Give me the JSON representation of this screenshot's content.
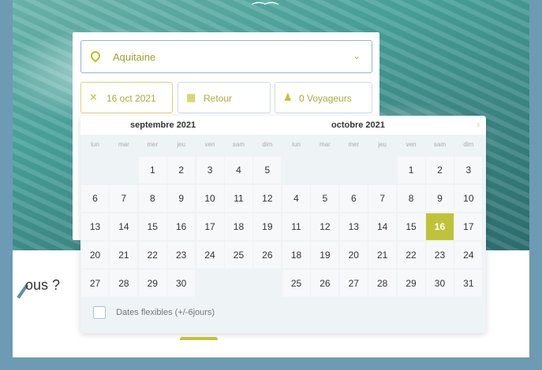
{
  "hero": {
    "title_mark": "..."
  },
  "below_text": "ous ?",
  "search": {
    "destination": "Aquitaine",
    "depart": "16 oct 2021",
    "retour": "Retour",
    "voyageurs": "0 Voyageurs"
  },
  "calendar": {
    "next_label": "›",
    "weekdays": [
      "lun",
      "mar",
      "mer",
      "jeu",
      "ven",
      "sam",
      "dim"
    ],
    "months": [
      {
        "title": "septembre 2021",
        "days": [
          "",
          "",
          "1",
          "2",
          "3",
          "4",
          "5",
          "6",
          "7",
          "8",
          "9",
          "10",
          "11",
          "12",
          "13",
          "14",
          "15",
          "16",
          "17",
          "18",
          "19",
          "20",
          "21",
          "22",
          "23",
          "24",
          "25",
          "26",
          "27",
          "28",
          "29",
          "30"
        ]
      },
      {
        "title": "octobre 2021",
        "days": [
          "",
          "",
          "",
          "",
          "1",
          "2",
          "3",
          "4",
          "5",
          "6",
          "7",
          "8",
          "9",
          "10",
          "11",
          "12",
          "13",
          "14",
          "15",
          "16",
          "17",
          "18",
          "19",
          "20",
          "21",
          "22",
          "23",
          "24",
          "25",
          "26",
          "27",
          "28",
          "29",
          "30",
          "31"
        ],
        "selected": "16"
      }
    ],
    "flexible_label": "Dates flexibles  (+/-6jours)"
  },
  "colors": {
    "accent": "#bfc33a",
    "frame": "#6d9bb3"
  },
  "icons": {
    "destination": "location-pin-icon",
    "date": "close-icon",
    "retour": "calendar-icon",
    "voyageurs": "people-icon"
  }
}
